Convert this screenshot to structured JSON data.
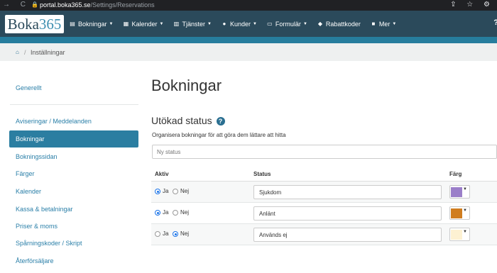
{
  "browser": {
    "nav_glyphs": "→ C",
    "url_domain": "portal.boka365.se",
    "url_path": "/Settings/Reservations",
    "tools_glyphs": "⇪ ☆ ⚙"
  },
  "brand": {
    "name_text": "Boka",
    "name_num": "365"
  },
  "menu": [
    {
      "label": "Bokningar",
      "icon": "calendar-list-icon",
      "glyph": "▤",
      "caret": true
    },
    {
      "label": "Kalender",
      "icon": "calendar-icon",
      "glyph": "▦",
      "caret": true
    },
    {
      "label": "Tjänster",
      "icon": "services-icon",
      "glyph": "▥",
      "caret": true
    },
    {
      "label": "Kunder",
      "icon": "users-icon",
      "glyph": "●",
      "caret": true
    },
    {
      "label": "Formulär",
      "icon": "form-icon",
      "glyph": "▭",
      "caret": true
    },
    {
      "label": "Rabattkoder",
      "icon": "tag-icon",
      "glyph": "◆",
      "caret": false
    },
    {
      "label": "Mer",
      "icon": "folder-icon",
      "glyph": "■",
      "caret": true
    }
  ],
  "help_label": "?",
  "breadcrumb": {
    "home_icon": "home-icon",
    "home_glyph": "⌂",
    "separator": "/",
    "current": "Inställningar"
  },
  "sidebar": {
    "general": "Generellt",
    "items": [
      "Aviseringar / Meddelanden",
      "Bokningar",
      "Bokningssidan",
      "Färger",
      "Kalender",
      "Kassa & betalningar",
      "Priser & moms",
      "Spårningskoder / Skript",
      "Återförsäljare"
    ],
    "active_index": 1
  },
  "main": {
    "title": "Bokningar",
    "section": "Utökad status",
    "section_help": "?",
    "description": "Organisera bokningar för att göra dem lättare att hitta",
    "new_status_placeholder": "Ny status",
    "headers": {
      "active": "Aktiv",
      "status": "Status",
      "color": "Färg"
    },
    "yes_label": "Ja",
    "no_label": "Nej",
    "rows": [
      {
        "active": true,
        "status": "Sjukdom",
        "color": "#9b7fc9"
      },
      {
        "active": true,
        "status": "Anlänt",
        "color": "#d07d1f"
      },
      {
        "active": false,
        "status": "Används ej",
        "color": "#fdf1d2"
      }
    ]
  },
  "colors": {
    "header_bg": "#2b4a5b",
    "accent_bar": "#267d9d",
    "active_item_bg": "#2b7ea1",
    "link": "#2a7fa8"
  }
}
